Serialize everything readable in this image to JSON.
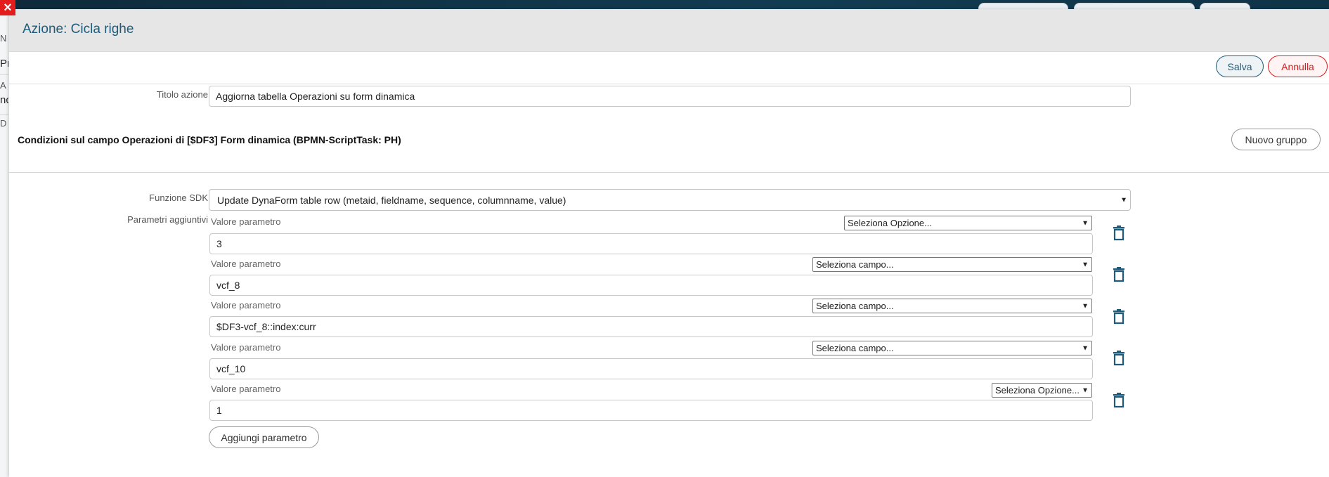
{
  "background": {
    "left_fragments": [
      "N",
      "Pr",
      "A",
      "nc",
      "D"
    ]
  },
  "close_icon": "×",
  "modal": {
    "title": "Azione: Cicla righe",
    "save_label": "Salva",
    "cancel_label": "Annulla"
  },
  "form": {
    "titolo_label": "Titolo azione",
    "titolo_value": "Aggiorna tabella Operazioni su form dinamica",
    "condition_title": "Condizioni sul campo Operazioni di [$DF3] Form dinamica (BPMN-ScriptTask: PH)",
    "new_group_label": "Nuovo gruppo",
    "sdk_label": "Funzione SDK",
    "sdk_value": "Update DynaForm table row (metaid, fieldname, sequence, columnname, value)",
    "params_label": "Parametri aggiuntivi",
    "add_param_label": "Aggiungi parametro",
    "params": [
      {
        "label": "Valore parametro",
        "select": "Seleziona Opzione...",
        "value": "3"
      },
      {
        "label": "Valore parametro",
        "select": "Seleziona campo...",
        "value": "vcf_8"
      },
      {
        "label": "Valore parametro",
        "select": "Seleziona campo...",
        "value": "$DF3-vcf_8::index:curr"
      },
      {
        "label": "Valore parametro",
        "select": "Seleziona campo...",
        "value": "vcf_10"
      },
      {
        "label": "Valore parametro",
        "select": "Seleziona Opzione...",
        "value": "1"
      }
    ]
  },
  "colors": {
    "accent": "#1f5b7a",
    "danger": "#d32020",
    "header_bg": "#e6e6e6"
  }
}
